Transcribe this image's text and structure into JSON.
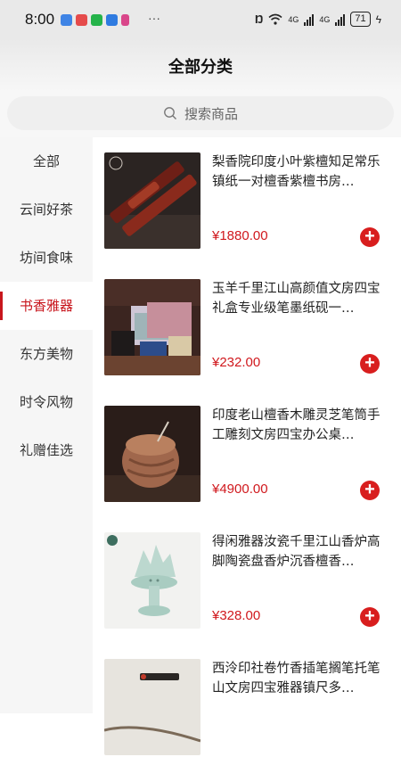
{
  "status": {
    "time": "8:00",
    "more": "···",
    "network": "4G",
    "battery": "71",
    "colors": {
      "app1": "#3f84e5",
      "app2": "#e54b4b",
      "app3": "#25b34a",
      "app4": "#2f7be0",
      "app5": "#d9468a"
    }
  },
  "header": {
    "title": "全部分类"
  },
  "search": {
    "placeholder": "搜索商品"
  },
  "sidebar": {
    "items": [
      {
        "label": "全部"
      },
      {
        "label": "云间好茶"
      },
      {
        "label": "坊间食味"
      },
      {
        "label": "书香雅器",
        "active": true
      },
      {
        "label": "东方美物"
      },
      {
        "label": "时令风物"
      },
      {
        "label": "礼赠佳选"
      }
    ]
  },
  "products": [
    {
      "name": "梨香院印度小叶紫檀知足常乐镇纸一对檀香紫檀书房…",
      "price": "¥1880.00"
    },
    {
      "name": "玉羊千里江山高颜值文房四宝礼盒专业级笔墨纸砚一…",
      "price": "¥232.00"
    },
    {
      "name": "印度老山檀香木雕灵芝笔筒手工雕刻文房四宝办公桌…",
      "price": "¥4900.00"
    },
    {
      "name": "得闲雅器汝瓷千里江山香炉高脚陶瓷盘香炉沉香檀香…",
      "price": "¥328.00"
    },
    {
      "name": "西泠印社卷竹香插笔搁笔托笔山文房四宝雅器镇尺多…",
      "price": ""
    }
  ],
  "accent": "#c8161d"
}
